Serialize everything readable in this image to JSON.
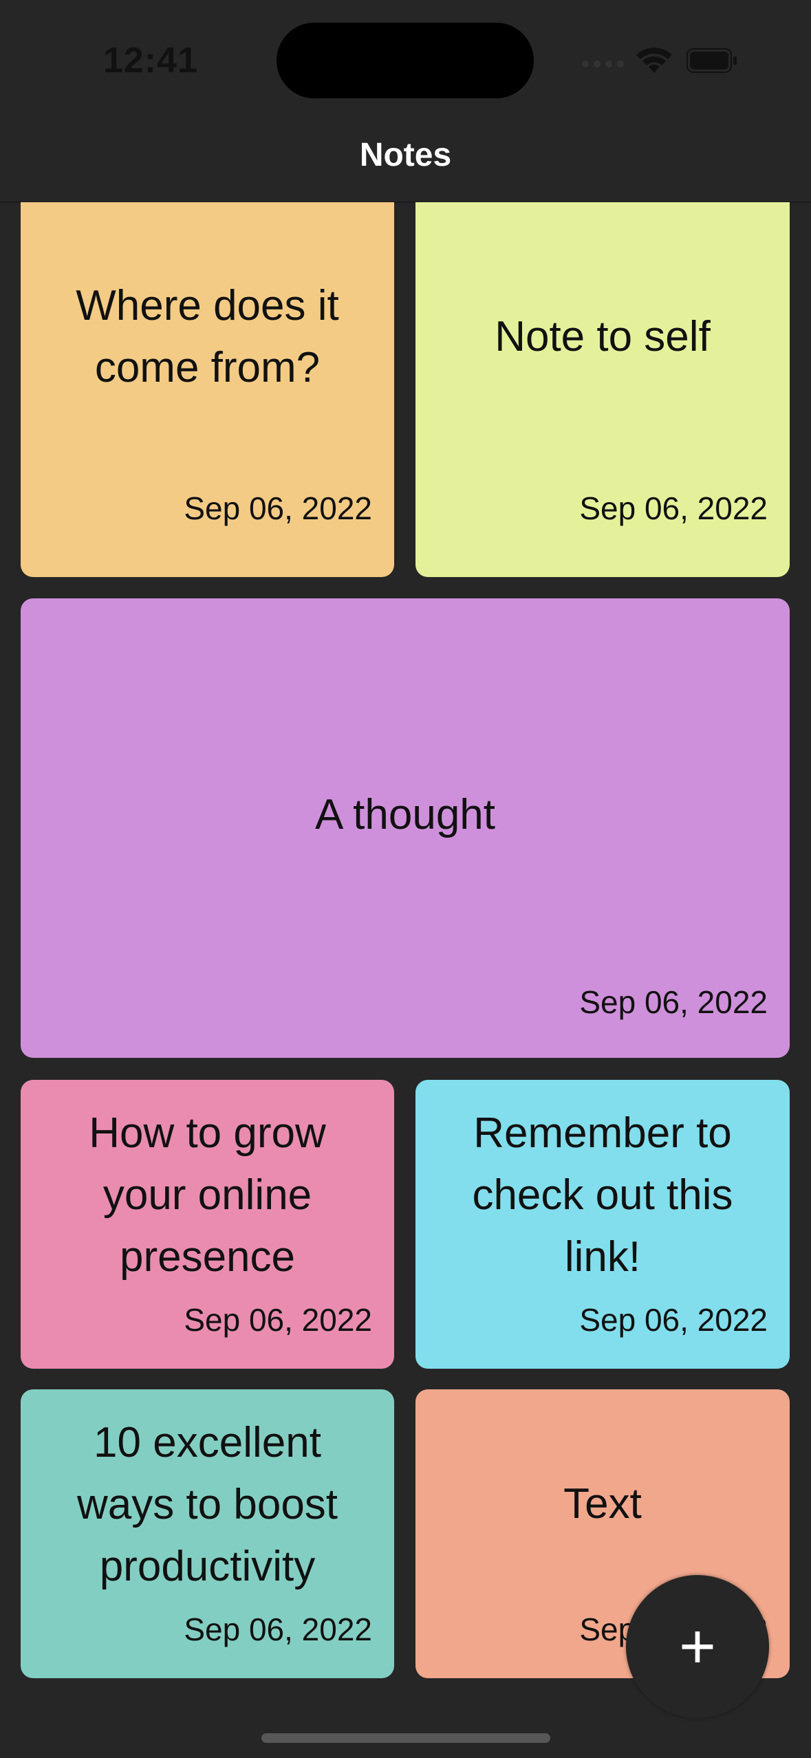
{
  "status_bar": {
    "time": "12:41"
  },
  "header": {
    "title": "Notes"
  },
  "notes": [
    {
      "title": "Where does it come from?",
      "date": "Sep 06, 2022",
      "color": "#F3CB84"
    },
    {
      "title": "Note to self",
      "date": "Sep 06, 2022",
      "color": "#E4F19A"
    },
    {
      "title": "A thought",
      "date": "Sep 06, 2022",
      "color": "#CF90DB"
    },
    {
      "title": "How to grow your online presence",
      "date": "Sep 06, 2022",
      "color": "#E98CB0"
    },
    {
      "title": "Remember to check out this link!",
      "date": "Sep 06, 2022",
      "color": "#82DEEC"
    },
    {
      "title": "10 excellent ways to boost productivity",
      "date": "Sep 06, 2022",
      "color": "#83CEC2"
    },
    {
      "title": "Text",
      "date": "Sep 06, 2022",
      "color": "#F1A78C"
    }
  ],
  "fab": {
    "label": "+"
  }
}
